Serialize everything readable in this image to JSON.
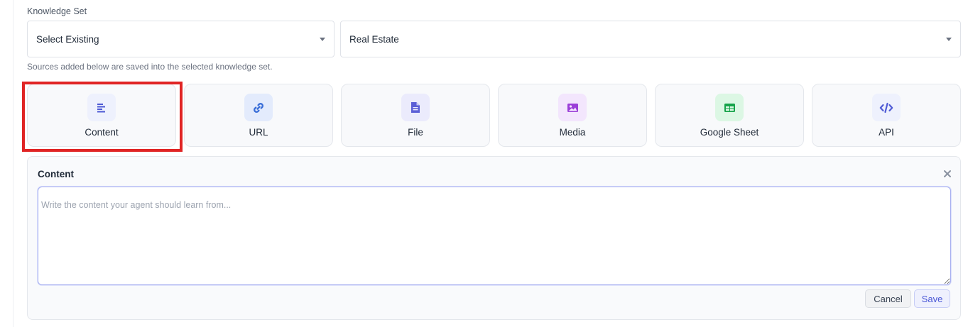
{
  "knowledge_set": {
    "label": "Knowledge Set",
    "mode_select": "Select Existing",
    "set_select": "Real Estate",
    "help_text": "Sources added below are saved into the selected knowledge set."
  },
  "sources": [
    {
      "label": "Content",
      "icon": "content-lines-icon",
      "icon_color": "#4f5bd5",
      "icon_bg": "#eef1fd"
    },
    {
      "label": "URL",
      "icon": "link-icon",
      "icon_color": "#3b6fd8",
      "icon_bg": "#e3ebfc"
    },
    {
      "label": "File",
      "icon": "file-icon",
      "icon_color": "#5b5fd6",
      "icon_bg": "#ebebfc"
    },
    {
      "label": "Media",
      "icon": "image-icon",
      "icon_color": "#9b3fd8",
      "icon_bg": "#f3e6fd"
    },
    {
      "label": "Google Sheet",
      "icon": "sheet-icon",
      "icon_color": "#16a34a",
      "icon_bg": "#dcf7e4"
    },
    {
      "label": "API",
      "icon": "code-icon",
      "icon_color": "#4f5bd5",
      "icon_bg": "#eef1fd"
    }
  ],
  "selected_source": "Content",
  "highlight_color": "#e02424",
  "panel": {
    "title": "Content",
    "placeholder": "Write the content your agent should learn from...",
    "value": "",
    "cancel_label": "Cancel",
    "save_label": "Save"
  }
}
